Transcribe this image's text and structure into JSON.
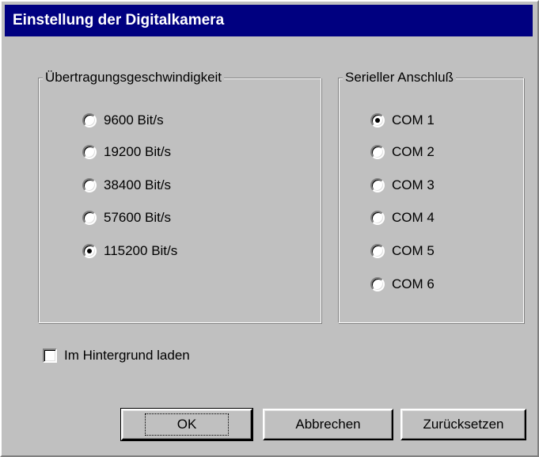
{
  "window": {
    "title": "Einstellung der Digitalkamera"
  },
  "speed_group": {
    "legend": "Übertragungsgeschwindigkeit",
    "options": [
      {
        "label": "9600 Bit/s",
        "checked": false
      },
      {
        "label": "19200 Bit/s",
        "checked": false
      },
      {
        "label": "38400 Bit/s",
        "checked": false
      },
      {
        "label": "57600 Bit/s",
        "checked": false
      },
      {
        "label": "115200 Bit/s",
        "checked": true
      }
    ]
  },
  "port_group": {
    "legend": "Serieller Anschluß",
    "options": [
      {
        "label": "COM 1",
        "checked": true
      },
      {
        "label": "COM 2",
        "checked": false
      },
      {
        "label": "COM 3",
        "checked": false
      },
      {
        "label": "COM 4",
        "checked": false
      },
      {
        "label": "COM 5",
        "checked": false
      },
      {
        "label": "COM 6",
        "checked": false
      }
    ]
  },
  "background_load": {
    "label": "Im Hintergrund laden",
    "checked": false
  },
  "buttons": {
    "ok": "OK",
    "cancel": "Abbrechen",
    "reset": "Zurücksetzen"
  },
  "colors": {
    "titlebar": "#000080",
    "face": "#c0c0c0"
  }
}
